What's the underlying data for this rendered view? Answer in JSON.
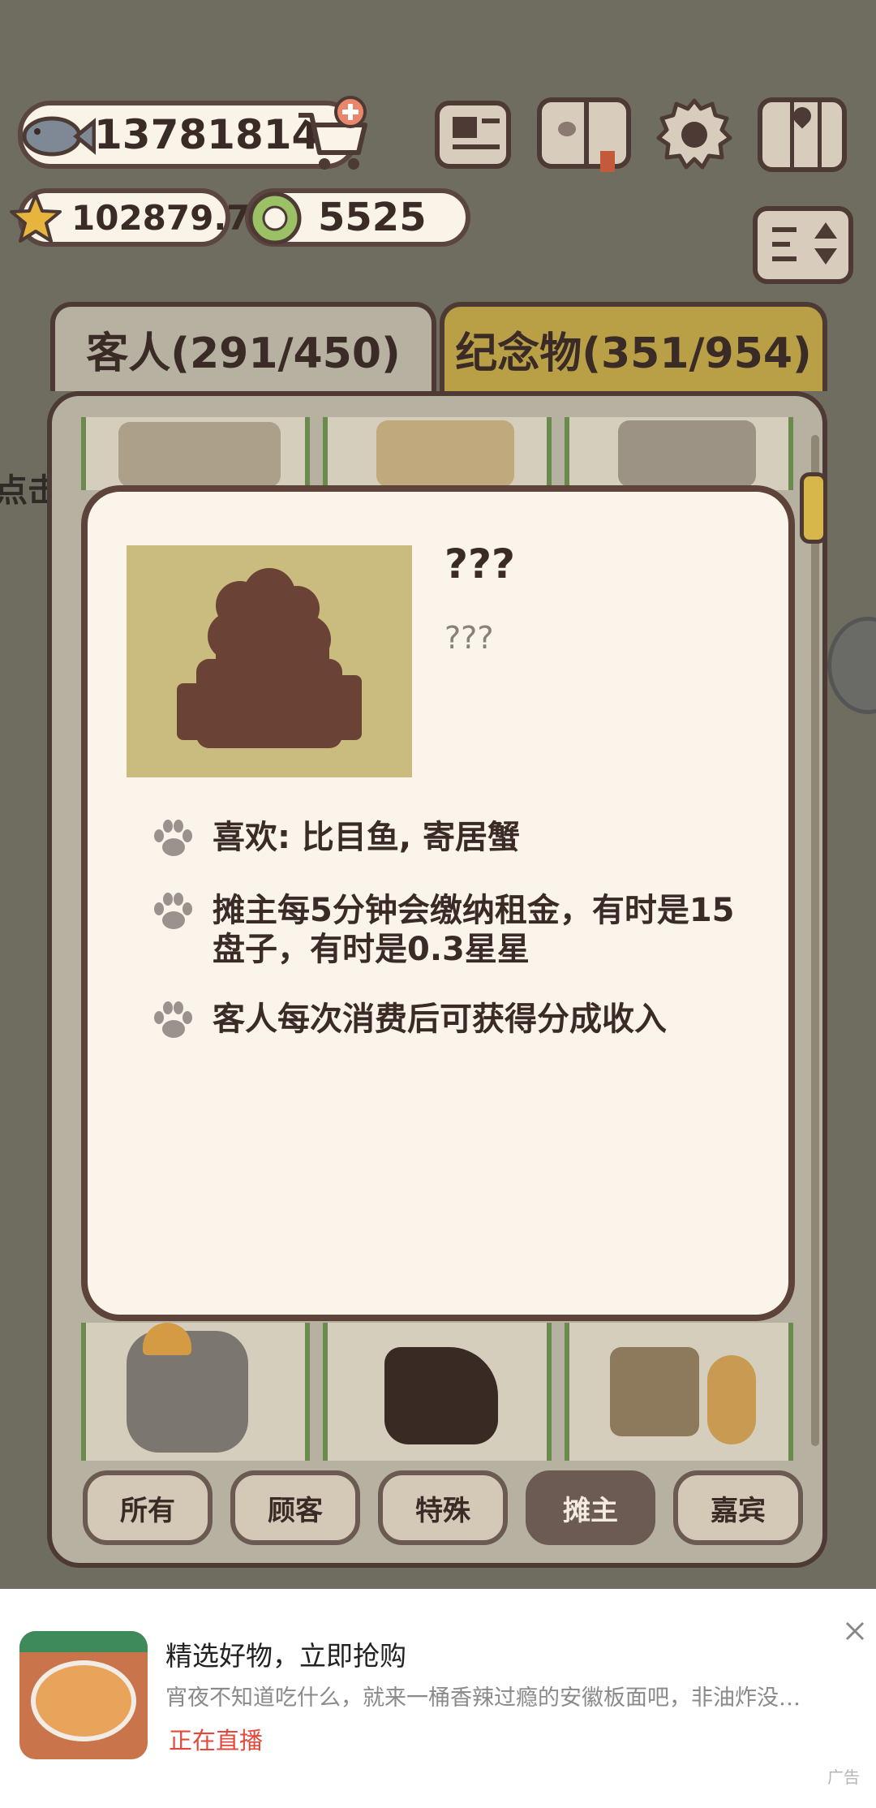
{
  "currency": {
    "fish": "13781814",
    "stars": "102879.7",
    "coins": "5525"
  },
  "tabs": {
    "guests": "客人(291/450)",
    "souvenirs": "纪念物(351/954)"
  },
  "side_text": "点击",
  "detail": {
    "name": "???",
    "subtitle": "???",
    "bullets": [
      "喜欢: 比目鱼, 寄居蟹",
      "摊主每5分钟会缴纳租金，有时是15盘子，有时是0.3星星",
      "客人每次消费后可获得分成收入"
    ]
  },
  "filters": [
    "所有",
    "顾客",
    "特殊",
    "摊主",
    "嘉宾"
  ],
  "active_filter": "摊主",
  "ad": {
    "title": "精选好物，立即抢购",
    "description": "宵夜不知道吃什么，就来一桶香辣过瘾的安徽板面吧，非油炸没…",
    "status": "正在直播",
    "label": "广告"
  },
  "colors": {
    "panel_border": "#4d3a35",
    "active_tab": "#b9a046",
    "silhouette": "#6b4336",
    "silhouette_bg": "#c9bc7e"
  },
  "icons": [
    "fish-icon",
    "cart-add-icon",
    "star-icon",
    "coin-icon",
    "newspaper-icon",
    "paw-book-icon",
    "gear-icon",
    "map-icon",
    "sort-icon",
    "paw-icon",
    "close-icon"
  ]
}
